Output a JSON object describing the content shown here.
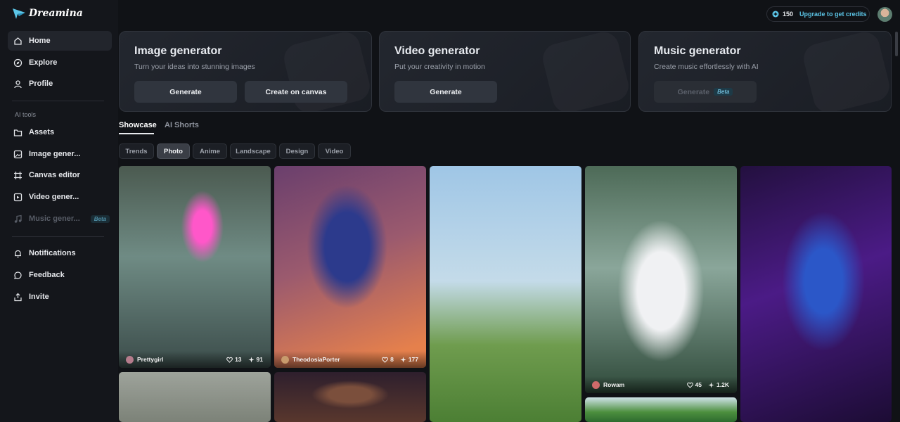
{
  "app": {
    "name": "Dreamina"
  },
  "sidebar": {
    "items": [
      {
        "label": "Home",
        "icon": "home-icon"
      },
      {
        "label": "Explore",
        "icon": "compass-icon"
      },
      {
        "label": "Profile",
        "icon": "user-icon"
      }
    ],
    "ai_tools_label": "AI tools",
    "tools": [
      {
        "label": "Assets",
        "icon": "folder-icon"
      },
      {
        "label": "Image gener...",
        "icon": "image-icon"
      },
      {
        "label": "Canvas editor",
        "icon": "canvas-icon"
      },
      {
        "label": "Video gener...",
        "icon": "video-icon"
      },
      {
        "label": "Music gener...",
        "icon": "music-icon",
        "badge": "Beta"
      }
    ],
    "bottom": [
      {
        "label": "Notifications",
        "icon": "bell-icon"
      },
      {
        "label": "Feedback",
        "icon": "chat-icon"
      },
      {
        "label": "Invite",
        "icon": "share-icon"
      }
    ]
  },
  "header": {
    "credits": "150",
    "upgrade": "Upgrade to get credits"
  },
  "generators": [
    {
      "title": "Image generator",
      "subtitle": "Turn your ideas into stunning images",
      "buttons": [
        "Generate",
        "Create on canvas"
      ]
    },
    {
      "title": "Video generator",
      "subtitle": "Put your creativity in motion",
      "buttons": [
        "Generate"
      ]
    },
    {
      "title": "Music generator",
      "subtitle": "Create music effortlessly with AI",
      "buttons": [
        "Generate"
      ],
      "badge": "Beta"
    }
  ],
  "tabs": [
    "Showcase",
    "AI Shorts"
  ],
  "filters": [
    "Trends",
    "Photo",
    "Anime",
    "Landscape",
    "Design",
    "Video"
  ],
  "cards": [
    {
      "user": "Prettygirl",
      "likes": "13",
      "uses": "91"
    },
    {
      "user": "TheodosiaPorter",
      "likes": "8",
      "uses": "177"
    },
    {
      "user": "Rowam",
      "likes": "45",
      "uses": "1.2K"
    }
  ],
  "colors": {
    "accent": "#5cc6e8",
    "background": "#101216",
    "sidebar": "#14161b"
  }
}
